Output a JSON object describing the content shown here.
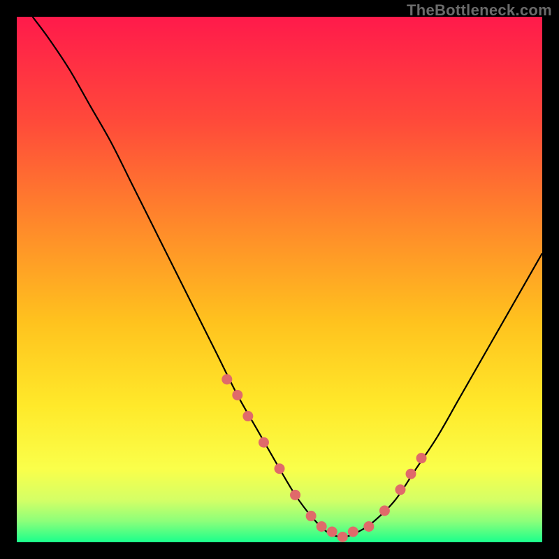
{
  "watermark": "TheBottleneck.com",
  "chart_data": {
    "type": "line",
    "title": "",
    "xlabel": "",
    "ylabel": "",
    "xlim": [
      0,
      100
    ],
    "ylim": [
      0,
      100
    ],
    "grid": false,
    "series": [
      {
        "name": "bottleneck-curve",
        "x": [
          3,
          6,
          10,
          14,
          18,
          22,
          26,
          30,
          34,
          38,
          42,
          46,
          50,
          53,
          56,
          59,
          62,
          65,
          68,
          72,
          76,
          80,
          84,
          88,
          92,
          96,
          100
        ],
        "y": [
          100,
          96,
          90,
          83,
          76,
          68,
          60,
          52,
          44,
          36,
          28,
          21,
          14,
          9,
          5,
          2,
          1,
          2,
          4,
          8,
          14,
          20,
          27,
          34,
          41,
          48,
          55
        ]
      }
    ],
    "markers": {
      "name": "highlighted-points",
      "color": "#e06a6a",
      "x": [
        40,
        42,
        44,
        47,
        50,
        53,
        56,
        58,
        60,
        62,
        64,
        67,
        70,
        73,
        75,
        77
      ],
      "y": [
        31,
        28,
        24,
        19,
        14,
        9,
        5,
        3,
        2,
        1,
        2,
        3,
        6,
        10,
        13,
        16
      ]
    },
    "gradient_stops": [
      {
        "offset": 0.0,
        "color": "#ff1a4b"
      },
      {
        "offset": 0.2,
        "color": "#ff4a3a"
      },
      {
        "offset": 0.4,
        "color": "#ff8a2a"
      },
      {
        "offset": 0.58,
        "color": "#ffc21e"
      },
      {
        "offset": 0.74,
        "color": "#ffe92a"
      },
      {
        "offset": 0.86,
        "color": "#faff4a"
      },
      {
        "offset": 0.92,
        "color": "#d4ff66"
      },
      {
        "offset": 0.96,
        "color": "#8cff7a"
      },
      {
        "offset": 1.0,
        "color": "#1aff8c"
      }
    ]
  }
}
